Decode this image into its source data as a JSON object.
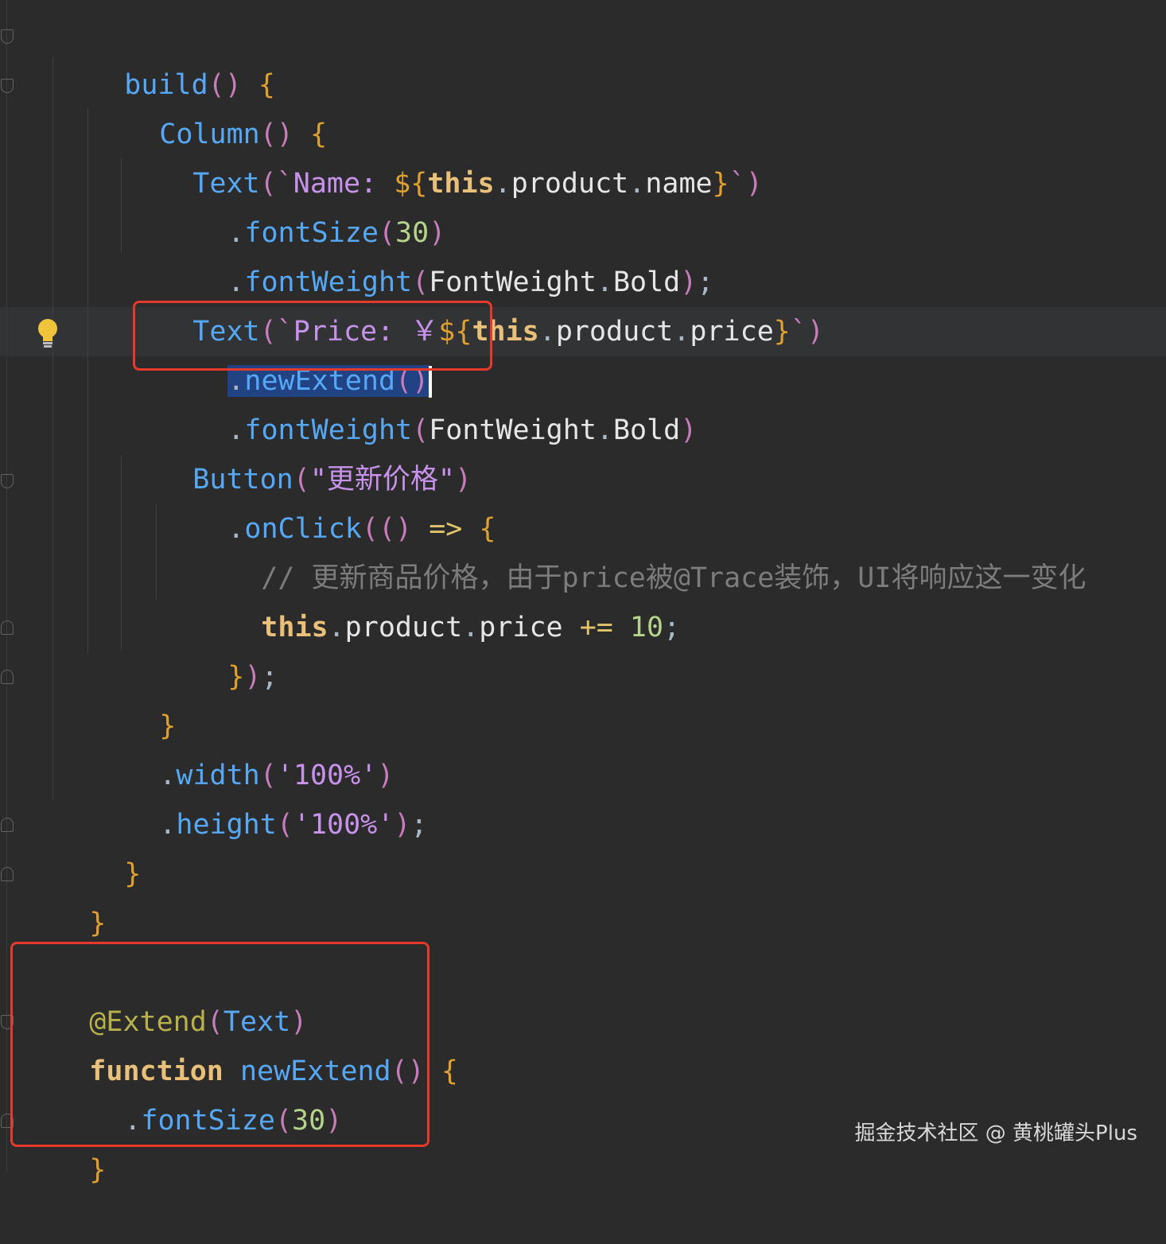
{
  "colors": {
    "background": "#2b2b2b",
    "highlight_box": "#e53a2b",
    "selection": "#214283"
  },
  "icons": {
    "gutter_bulb": "lightbulb-icon",
    "fold_markers": "fold-icon"
  },
  "code": {
    "build_line": {
      "name": "build",
      "paren": "()",
      "brace": "{"
    },
    "column_line": {
      "name": "Column",
      "paren": "()",
      "brace": "{"
    },
    "text1_line": {
      "name": "Text",
      "open": "(`",
      "label": "Name: ",
      "interp_open": "${",
      "kw_this": "this",
      "dot1": ".",
      "prop1": "product",
      "dot2": ".",
      "prop2": "name",
      "interp_close": "}",
      "close": "`)"
    },
    "fontsize1_line": {
      "dot": ".",
      "method": "fontSize",
      "open": "(",
      "value": "30",
      "close": ")"
    },
    "fontweight1_line": {
      "dot": ".",
      "method": "fontWeight",
      "open": "(",
      "arg1": "FontWeight",
      "dot2": ".",
      "arg2": "Bold",
      "close": ")",
      "semi": ";"
    },
    "text2_line": {
      "name": "Text",
      "open": "(`",
      "label": "Price: ",
      "yen": "￥",
      "interp_open": "${",
      "kw_this": "this",
      "dot1": ".",
      "prop1": "product",
      "dot2": ".",
      "prop2": "price",
      "interp_close": "}",
      "close": "`)"
    },
    "newextend_line": {
      "dot": ".",
      "method": "newExtend",
      "paren": "()"
    },
    "fontweight2_line": {
      "dot": ".",
      "method": "fontWeight",
      "open": "(",
      "arg1": "FontWeight",
      "dot2": ".",
      "arg2": "Bold",
      "close": ")"
    },
    "button_line": {
      "name": "Button",
      "open": "(",
      "label": "\"更新价格\"",
      "close": ")"
    },
    "onclick_line": {
      "dot": ".",
      "method": "onClick",
      "open": "((",
      "paren_close": ")",
      "arrow": " => ",
      "brace": "{"
    },
    "comment_line": {
      "text": "// 更新商品价格，由于price被@Trace装饰，UI将响应这一变化"
    },
    "assign_line": {
      "kw_this": "this",
      "dot1": ".",
      "prop1": "product",
      "dot2": ".",
      "prop2": "price",
      "op": " += ",
      "value": "10",
      "semi": ";"
    },
    "close_onclick_line": {
      "brace": "}",
      "paren": ")",
      "semi": ";"
    },
    "close_column_line": {
      "brace": "}"
    },
    "width_line": {
      "dot": ".",
      "method": "width",
      "open": "(",
      "value": "'100%'",
      "close": ")"
    },
    "height_line": {
      "dot": ".",
      "method": "height",
      "open": "(",
      "value": "'100%'",
      "close": ")",
      "semi": ";"
    },
    "close_build_line": {
      "brace": "}"
    },
    "close_struct_line": {
      "brace": "}"
    },
    "decorator_line": {
      "annotation": "@Extend",
      "open": "(",
      "arg": "Text",
      "close": ")"
    },
    "function_line": {
      "keyword": "function",
      "name": "newExtend",
      "paren": "()",
      "brace": "{"
    },
    "fontsize2_line": {
      "dot": ".",
      "method": "fontSize",
      "open": "(",
      "value": "30",
      "close": ")"
    },
    "close_function_line": {
      "brace": "}"
    }
  },
  "watermark": "掘金技术社区 @ 黄桃罐头Plus"
}
